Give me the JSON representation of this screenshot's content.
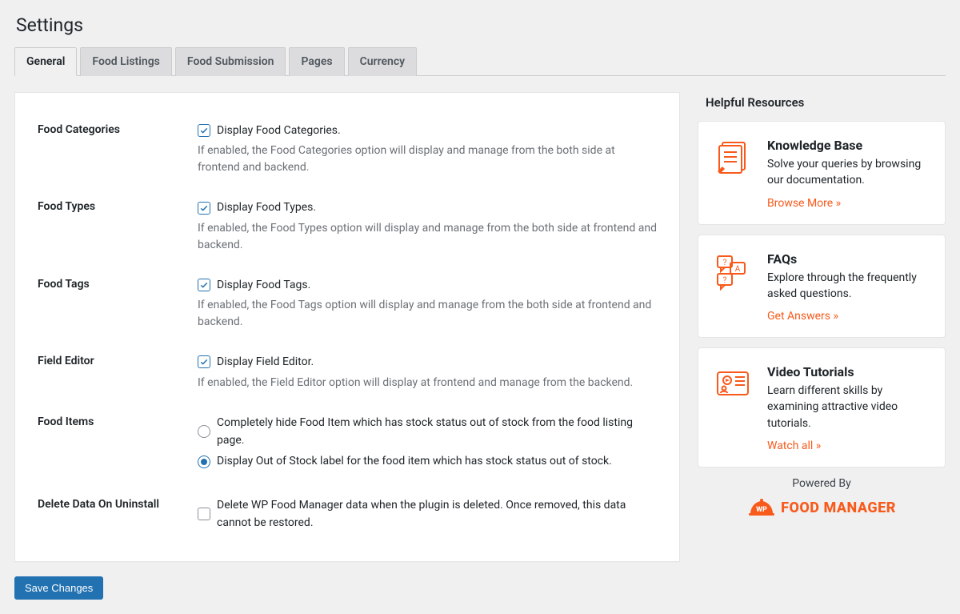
{
  "page_title": "Settings",
  "tabs": [
    "General",
    "Food Listings",
    "Food Submission",
    "Pages",
    "Currency"
  ],
  "active_tab": 0,
  "settings": {
    "food_categories": {
      "label": "Food Categories",
      "check_label": "Display Food Categories.",
      "desc": "If enabled, the Food Categories option will display and manage from the both side at frontend and backend."
    },
    "food_types": {
      "label": "Food Types",
      "check_label": "Display Food Types.",
      "desc": "If enabled, the Food Types option will display and manage from the both side at frontend and backend."
    },
    "food_tags": {
      "label": "Food Tags",
      "check_label": "Display Food Tags.",
      "desc": "If enabled, the Food Tags option will display and manage from the both side at frontend and backend."
    },
    "field_editor": {
      "label": "Field Editor",
      "check_label": "Display Field Editor.",
      "desc": "If enabled, the Field Editor option will display at frontend and manage from the backend."
    },
    "food_items": {
      "label": "Food Items",
      "option1": "Completely hide Food Item which has stock status out of stock from the food listing page.",
      "option2": "Display Out of Stock label for the food item which has stock status out of stock."
    },
    "delete_data": {
      "label": "Delete Data On Uninstall",
      "check_label": "Delete WP Food Manager data when the plugin is deleted. Once removed, this data cannot be restored."
    }
  },
  "save_button": "Save Changes",
  "sidebar": {
    "heading": "Helpful Resources",
    "cards": {
      "kb": {
        "title": "Knowledge Base",
        "desc": "Solve your queries by browsing our documentation.",
        "link": "Browse More »"
      },
      "faq": {
        "title": "FAQs",
        "desc": "Explore through the frequently asked questions.",
        "link": "Get Answers »"
      },
      "videos": {
        "title": "Video Tutorials",
        "desc": "Learn different skills by examining attractive video tutorials.",
        "link": "Watch all »"
      }
    },
    "powered": "Powered By",
    "logo_badge": "WP",
    "logo_text": "FOOD MANAGER"
  }
}
